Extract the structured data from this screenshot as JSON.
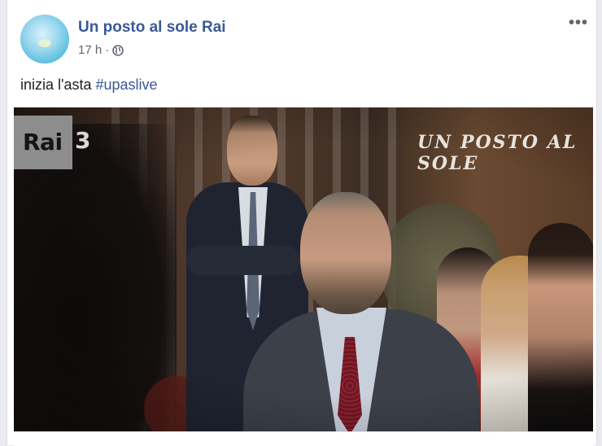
{
  "post": {
    "page_name": "Un posto al sole Rai",
    "time": "17 h",
    "separator": "·",
    "privacy_icon": "globe-icon",
    "more_label": "•••",
    "caption_text": "inizia l'asta ",
    "hashtag": "#upaslive"
  },
  "video": {
    "channel_logo_rai": "Rai",
    "channel_logo_number": "3",
    "show_logo": "UN POSTO AL SOLE"
  },
  "colors": {
    "link": "#385898",
    "text": "#1c1e21",
    "meta": "#616770",
    "background": "#e9ebee"
  }
}
